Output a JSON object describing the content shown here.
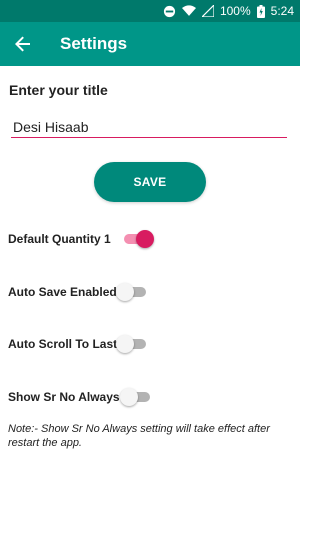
{
  "status_bar": {
    "battery": "100%",
    "time": "5:24",
    "icons": [
      "dnd-icon",
      "wifi-icon",
      "signal-icon",
      "battery-icon"
    ]
  },
  "app_bar": {
    "title": "Settings",
    "back_icon": "arrow-back-icon"
  },
  "title_section": {
    "label": "Enter your title",
    "value": "Desi Hisaab"
  },
  "save_label": "SAVE",
  "settings": [
    {
      "label": "Default Quantity 1",
      "enabled": true
    },
    {
      "label": "Auto Save Enabled",
      "enabled": false
    },
    {
      "label": "Auto Scroll To Last",
      "enabled": false
    },
    {
      "label": "Show Sr No Always",
      "enabled": false
    }
  ],
  "note": "Note:- Show Sr No Always setting will take effect after restart the app.",
  "colors": {
    "primary": "#009688",
    "primary_dark": "#00796b",
    "accent": "#d81b60"
  }
}
